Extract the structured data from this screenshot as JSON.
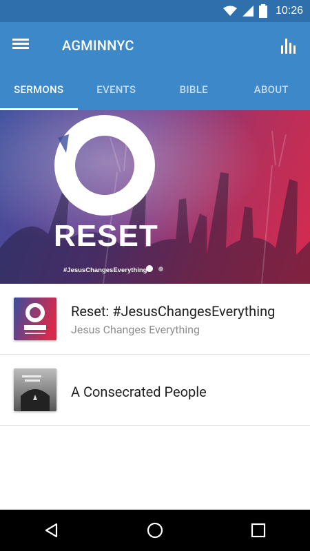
{
  "status_bar": {
    "time": "10:26"
  },
  "app_bar": {
    "title": "AGMINNYC"
  },
  "tabs": [
    {
      "label": "SERMONS",
      "active": true
    },
    {
      "label": "EVENTS",
      "active": false
    },
    {
      "label": "BIBLE",
      "active": false
    },
    {
      "label": "ABOUT",
      "active": false
    }
  ],
  "hero": {
    "title": "RESET",
    "hashtag": "#JesusChangesEverything",
    "slide_count": 2,
    "active_slide": 1
  },
  "sermons": [
    {
      "title": "Reset: #JesusChangesEverything",
      "subtitle": "Jesus Changes Everything"
    },
    {
      "title": "A Consecrated People",
      "subtitle": ""
    }
  ],
  "colors": {
    "status_bar": "#2f6fac",
    "app_bar": "#3d88c9",
    "hero_gradient_start": "#3b4d9c",
    "hero_gradient_end": "#d72a4c"
  },
  "icons": {
    "menu": "menu-icon",
    "stats": "bar-chart-icon",
    "wifi": "wifi-icon",
    "signal": "signal-icon",
    "battery": "battery-icon",
    "back": "back-icon",
    "home": "home-icon",
    "recents": "recents-icon"
  }
}
